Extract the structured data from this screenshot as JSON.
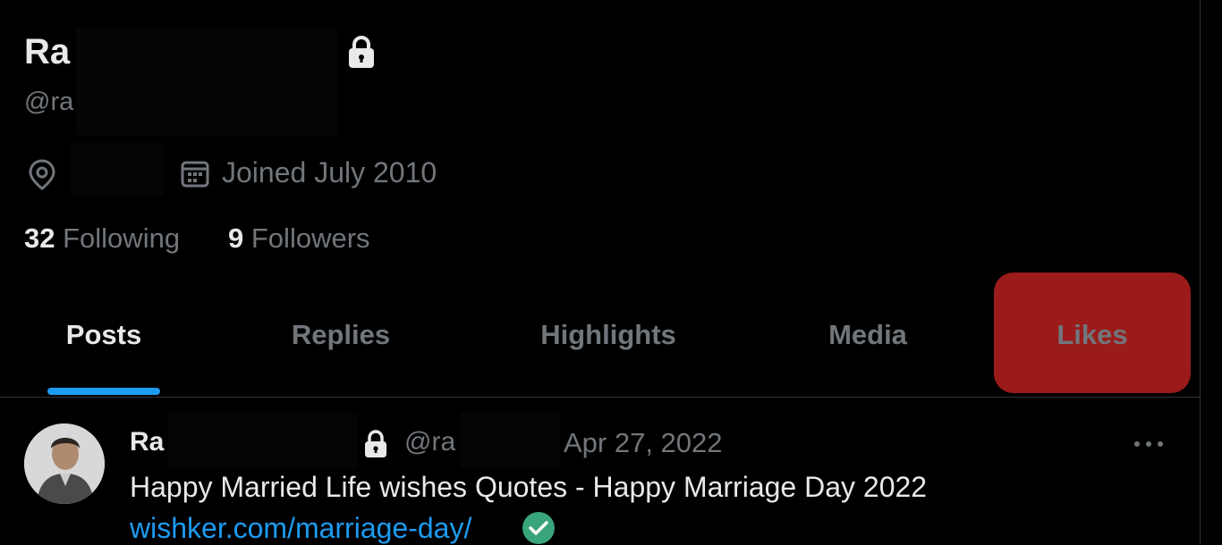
{
  "profile": {
    "name_visible": "Ra",
    "handle_visible": "@ra",
    "joined": "Joined July 2010",
    "following_count": "32",
    "following_label": "Following",
    "followers_count": "9",
    "followers_label": "Followers"
  },
  "tabs": [
    {
      "label": "Posts",
      "active": true
    },
    {
      "label": "Replies",
      "active": false
    },
    {
      "label": "Highlights",
      "active": false
    },
    {
      "label": "Media",
      "active": false
    },
    {
      "label": "Likes",
      "active": false
    }
  ],
  "post": {
    "author_visible": "Ra",
    "handle_visible": "@ra",
    "date": "Apr 27, 2022",
    "text": "Happy Married Life wishes Quotes - Happy Marriage Day 2022",
    "link": "wishker.com/marriage-day/"
  },
  "colors": {
    "background": "#000000",
    "text_primary": "#e7e9ea",
    "text_secondary": "#71767b",
    "accent_blue": "#1d9bf0",
    "likes_highlight": "#9b1b1b",
    "verified_green": "#3aa57a"
  },
  "icons": [
    "lock-icon",
    "location-icon",
    "calendar-icon",
    "more-icon",
    "check-circle-icon"
  ]
}
